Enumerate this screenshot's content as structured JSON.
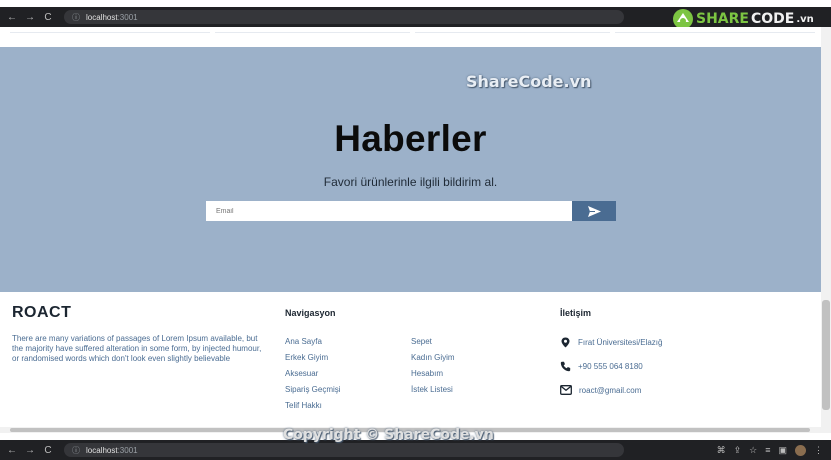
{
  "browser": {
    "url_host": "localhost",
    "url_port": ":3001",
    "back": "←",
    "forward": "→",
    "reload": "C",
    "info": "ⓘ"
  },
  "watermarks": {
    "top_logo_prefix": "SHARE",
    "top_logo_suffix": "CODE",
    "top_logo_domain": ".vn",
    "center": "ShareCode.vn",
    "bottom": "Copyright © ShareCode.vn"
  },
  "newsletter": {
    "title": "Haberler",
    "subtitle": "Favori ürünlerinle ilgili bildirim al.",
    "email_placeholder": "Email",
    "email_value": ""
  },
  "footer": {
    "brand": "ROACT",
    "brand_text": "There are many variations of passages of Lorem Ipsum available, but the majority have suffered alteration in some form, by injected humour, or randomised words which don't look even slightly believable",
    "nav_title": "Navigasyon",
    "nav_left": [
      "Ana Sayfa",
      "Erkek Giyim",
      "Aksesuar",
      "Sipariş Geçmişi",
      "Telif Hakkı"
    ],
    "nav_right": [
      "Sepet",
      "Kadın Giyim",
      "Hesabım",
      "İstek Listesi"
    ],
    "contact_title": "İletişim",
    "contact_address": "Fırat Üniversitesi/Elazığ",
    "contact_phone": "+90 555 064 8180",
    "contact_email": "roact@gmail.com"
  },
  "colors": {
    "newsletter_bg": "#9cb1c9",
    "accent": "#4a6c92",
    "dark": "#1c2631"
  }
}
